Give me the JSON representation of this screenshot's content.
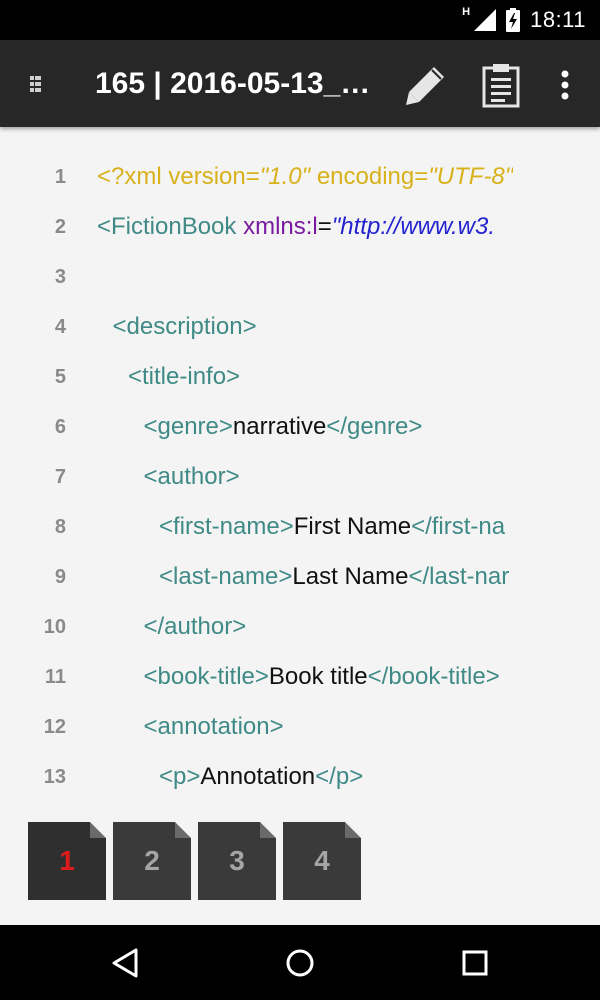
{
  "status_bar": {
    "time": "18:11",
    "network_label": "H"
  },
  "app_bar": {
    "title": "165 | 2016-05-13_…"
  },
  "editor": {
    "lines": [
      {
        "num": "1",
        "indent": 0,
        "tokens": [
          [
            "decl",
            "<?xml version="
          ],
          [
            "declval",
            "\"1.0\""
          ],
          [
            "decl",
            " encoding="
          ],
          [
            "declval",
            "\"UTF-8\""
          ]
        ]
      },
      {
        "num": "2",
        "indent": 0,
        "tokens": [
          [
            "tag",
            "<FictionBook "
          ],
          [
            "attr",
            "xmlns:l"
          ],
          [
            "eq",
            "="
          ],
          [
            "str",
            "\"http://www.w3."
          ]
        ]
      },
      {
        "num": "3",
        "indent": 0,
        "tokens": []
      },
      {
        "num": "4",
        "indent": 1,
        "tokens": [
          [
            "tag",
            "<description>"
          ]
        ]
      },
      {
        "num": "5",
        "indent": 2,
        "tokens": [
          [
            "tag",
            "<title-info>"
          ]
        ]
      },
      {
        "num": "6",
        "indent": 3,
        "tokens": [
          [
            "tag",
            "<genre>"
          ],
          [
            "text",
            "narrative"
          ],
          [
            "tag",
            "</genre>"
          ]
        ]
      },
      {
        "num": "7",
        "indent": 3,
        "tokens": [
          [
            "tag",
            "<author>"
          ]
        ]
      },
      {
        "num": "8",
        "indent": 4,
        "tokens": [
          [
            "tag",
            "<first-name>"
          ],
          [
            "text",
            "First Name"
          ],
          [
            "tag",
            "</first-na"
          ]
        ]
      },
      {
        "num": "9",
        "indent": 4,
        "tokens": [
          [
            "tag",
            "<last-name>"
          ],
          [
            "text",
            "Last Name"
          ],
          [
            "tag",
            "</last-nar"
          ]
        ]
      },
      {
        "num": "10",
        "indent": 3,
        "tokens": [
          [
            "tag",
            "</author>"
          ]
        ]
      },
      {
        "num": "11",
        "indent": 3,
        "tokens": [
          [
            "tag",
            "<book-title>"
          ],
          [
            "text",
            "Book title"
          ],
          [
            "tag",
            "</book-title>"
          ]
        ]
      },
      {
        "num": "12",
        "indent": 3,
        "tokens": [
          [
            "tag",
            "<annotation>"
          ]
        ]
      },
      {
        "num": "13",
        "indent": 4,
        "tokens": [
          [
            "tag",
            "<p>"
          ],
          [
            "text",
            "Annotation"
          ],
          [
            "tag",
            "</p>"
          ]
        ]
      }
    ]
  },
  "tabs": [
    {
      "label": "1",
      "active": true
    },
    {
      "label": "2",
      "active": false
    },
    {
      "label": "3",
      "active": false
    },
    {
      "label": "4",
      "active": false
    }
  ],
  "nav_bar": {
    "back": "back-icon",
    "home": "home-icon",
    "recents": "recents-icon"
  },
  "colors": {
    "declaration": "#d8b11c",
    "tag": "#3f8a86",
    "attribute": "#7a1aa0",
    "string": "#2323d0",
    "text": "#111111",
    "active_tab": "#e01b1b"
  }
}
